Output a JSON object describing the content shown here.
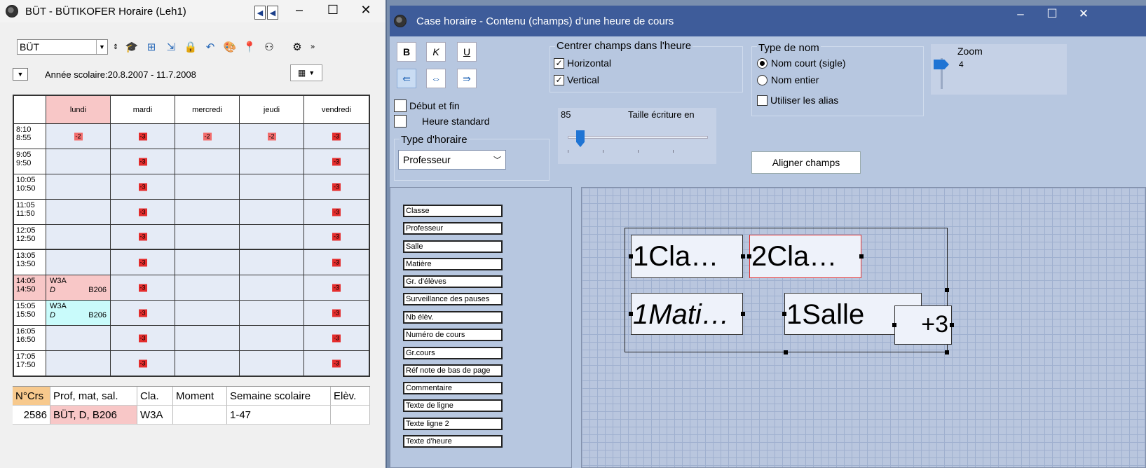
{
  "left_window": {
    "title": "BÜT - BÜTIKOFER  Horaire  (Leh1)",
    "teacher_combo": "BÜT",
    "year_label": "Année scolaire:20.8.2007 - 11.7.2008",
    "days": [
      "lundi",
      "mardi",
      "mercredi",
      "jeudi",
      "vendredi"
    ],
    "periods": [
      {
        "start": "8:10",
        "end": "8:55"
      },
      {
        "start": "9:05",
        "end": "9:50"
      },
      {
        "start": "10:05",
        "end": "10:50"
      },
      {
        "start": "11:05",
        "end": "11:50"
      },
      {
        "start": "12:05",
        "end": "12:50"
      },
      {
        "start": "13:05",
        "end": "13:50"
      },
      {
        "start": "14:05",
        "end": "14:50"
      },
      {
        "start": "15:05",
        "end": "15:50"
      },
      {
        "start": "16:05",
        "end": "16:50"
      },
      {
        "start": "17:05",
        "end": "17:50"
      }
    ],
    "badges": {
      "minus2": "-2",
      "minus3": "-3"
    },
    "lessons": [
      {
        "class": "W3A",
        "subject": "D",
        "room": "B206"
      },
      {
        "class": "W3A",
        "subject": "D",
        "room": "B206"
      }
    ],
    "course_table": {
      "headers": [
        "N°Crs",
        "Prof, mat, sal.",
        "Cla.",
        "Moment",
        "Semaine scolaire",
        "Elèv."
      ],
      "row": [
        "2586",
        "BÜT, D, B206",
        "W3A",
        "",
        "1-47",
        ""
      ]
    }
  },
  "right_window": {
    "title": "Case horaire - Contenu (champs) d'une heure de cours",
    "format": {
      "bold": "B",
      "italic": "K",
      "underline": "U"
    },
    "center_group": {
      "title": "Centrer champs dans l'heure",
      "horizontal": "Horizontal",
      "vertical": "Vertical"
    },
    "name_type": {
      "title": "Type de nom",
      "short": "Nom court (sigle)",
      "full": "Nom entier",
      "alias": "Utiliser les alias"
    },
    "zoom": {
      "label": "Zoom",
      "value": "4"
    },
    "start_end": "Début et fin",
    "standard_hour": "Heure standard",
    "schedule_type": {
      "title": "Type d'horaire",
      "value": "Professeur"
    },
    "font_size": {
      "value": "85",
      "label": "Taille écriture en"
    },
    "align_button": "Aligner champs",
    "fields": [
      "Classe",
      "Professeur",
      "Salle",
      "Matière",
      "Gr. d'élèves",
      "Surveillance des pauses",
      "Nb élèv.",
      "Numéro de cours",
      "Gr.cours",
      "Réf note de bas de page",
      "Commentaire",
      "Texte de ligne",
      "Texte ligne 2",
      "Texte d'heure"
    ],
    "canvas_boxes": {
      "box1": "1Cla…",
      "box2": "2Cla…",
      "box3": "1Mati…",
      "box4": "1Salle",
      "box5": "+3"
    }
  }
}
